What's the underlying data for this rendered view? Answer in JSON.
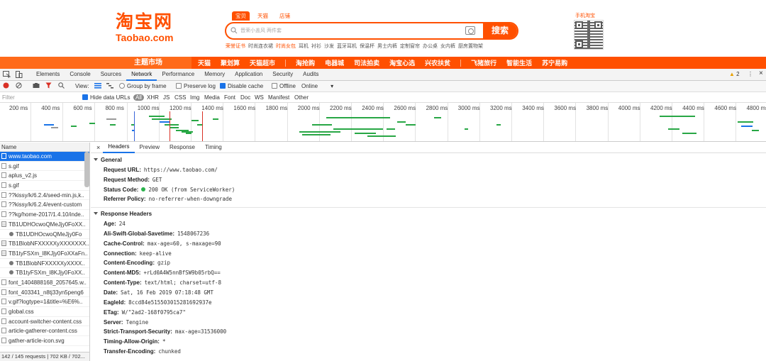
{
  "taobao": {
    "logo_cn": "淘宝网",
    "logo_en": "Taobao.com",
    "search_tabs": [
      "宝贝",
      "天猫",
      "店铺"
    ],
    "search_placeholder": "晋荣小盖风 两件套",
    "search_button": "搜索",
    "hotwords": [
      "荣誉证书",
      "时尚连衣裙",
      "时尚女包",
      "耳机",
      "衬衫",
      "沙发",
      "蓝牙耳机",
      "保温杯",
      "男士内裤",
      "定制窗帘",
      "办公桌",
      "女内裤",
      "厨房置物架"
    ],
    "mobile_label": "手机淘宝",
    "nav_theme": "主题市场",
    "nav_items": [
      "天猫",
      "聚划算",
      "天猫超市",
      "淘抢购",
      "电器城",
      "司法拍卖",
      "淘宝心选",
      "兴农扶贫",
      "飞猪旅行",
      "智能生活",
      "苏宁易购"
    ]
  },
  "devtools": {
    "tabs": [
      "Elements",
      "Console",
      "Sources",
      "Network",
      "Performance",
      "Memory",
      "Application",
      "Security",
      "Audits"
    ],
    "active_tab": "Network",
    "warnings_count": "2",
    "netbar": {
      "view_label": "View:",
      "group_by_frame": "Group by frame",
      "preserve_log": "Preserve log",
      "disable_cache": "Disable cache",
      "offline": "Offline",
      "throttle": "Online"
    },
    "filter": {
      "placeholder": "Filter",
      "hide_data_urls": "Hide data URLs",
      "types": [
        "All",
        "XHR",
        "JS",
        "CSS",
        "Img",
        "Media",
        "Font",
        "Doc",
        "WS",
        "Manifest",
        "Other"
      ]
    },
    "timeline_ticks": [
      "200 ms",
      "400 ms",
      "600 ms",
      "800 ms",
      "1000 ms",
      "1200 ms",
      "1400 ms",
      "1600 ms",
      "1800 ms",
      "2000 ms",
      "2200 ms",
      "2400 ms",
      "2600 ms",
      "2800 ms",
      "3000 ms",
      "3200 ms",
      "3400 ms",
      "3600 ms",
      "3800 ms",
      "4000 ms",
      "4200 ms",
      "4400 ms",
      "4600 ms",
      "4800 ms"
    ],
    "request_list": {
      "header": "Name",
      "rows": [
        {
          "name": "www.taobao.com",
          "kind": "doc"
        },
        {
          "name": "s.gif",
          "kind": "doc"
        },
        {
          "name": "aplus_v2.js",
          "kind": "doc"
        },
        {
          "name": "s.gif",
          "kind": "doc"
        },
        {
          "name": "??kissy/k/6.2.4/seed-min.js,k..",
          "kind": "doc"
        },
        {
          "name": "??kissy/k/6.2.4/event-custom",
          "kind": "doc"
        },
        {
          "name": "??kg/home-2017/1.4.10/inde..",
          "kind": "doc"
        },
        {
          "name": "TB1UDHOcwoQMeJjy0FoXX..",
          "kind": "img"
        },
        {
          "name": "TB1UDHOcwoQMeJjy0Fo",
          "kind": "gear"
        },
        {
          "name": "TB1BlobNFXXXXXyXXXXXXX..",
          "kind": "img"
        },
        {
          "name": "TB1tyFSXm_l8KJjy0FoXXaFn..",
          "kind": "img"
        },
        {
          "name": "TB1BlobNFXXXXXyXXXX..",
          "kind": "gear"
        },
        {
          "name": "TB1tyFSXm_l8KJjy0FoXX..",
          "kind": "gear"
        },
        {
          "name": "font_1404888168_2057645.w..",
          "kind": "doc"
        },
        {
          "name": "font_403341_n8tj33yn5peng6",
          "kind": "doc"
        },
        {
          "name": "v.gif?logtype=1&title=%E6%..",
          "kind": "doc"
        },
        {
          "name": "global.css",
          "kind": "doc"
        },
        {
          "name": "account-switcher-content.css",
          "kind": "doc"
        },
        {
          "name": "article-gatherer-content.css",
          "kind": "doc"
        },
        {
          "name": "gather-article-icon.svg",
          "kind": "doc"
        }
      ],
      "status": "142 / 145 requests | 702 KB / 702..."
    },
    "detail": {
      "tabs": [
        "Headers",
        "Preview",
        "Response",
        "Timing"
      ],
      "active_tab": "Headers",
      "general_title": "General",
      "general": [
        {
          "k": "Request URL:",
          "v": "https://www.taobao.com/"
        },
        {
          "k": "Request Method:",
          "v": "GET"
        },
        {
          "k": "Status Code:",
          "v": "200 OK (from ServiceWorker)"
        },
        {
          "k": "Referrer Policy:",
          "v": "no-referrer-when-downgrade"
        }
      ],
      "response_title": "Response Headers",
      "response": [
        {
          "k": "Age:",
          "v": "24"
        },
        {
          "k": "Ali-Swift-Global-Savetime:",
          "v": "1548067236"
        },
        {
          "k": "Cache-Control:",
          "v": "max-age=60, s-maxage=90"
        },
        {
          "k": "Connection:",
          "v": "keep-alive"
        },
        {
          "k": "Content-Encoding:",
          "v": "gzip"
        },
        {
          "k": "Content-MD5:",
          "v": "+rLd0A4W5nnBfSW9b05rbQ=="
        },
        {
          "k": "Content-Type:",
          "v": "text/html; charset=utf-8"
        },
        {
          "k": "Date:",
          "v": "Sat, 16 Feb 2019 07:18:48 GMT"
        },
        {
          "k": "EagleId:",
          "v": "8ccd84e515503015281692937e"
        },
        {
          "k": "ETag:",
          "v": "W/\"2ad2-168f0795ca7\""
        },
        {
          "k": "Server:",
          "v": "Tengine"
        },
        {
          "k": "Strict-Transport-Security:",
          "v": "max-age=31536000"
        },
        {
          "k": "Timing-Allow-Origin:",
          "v": "*"
        },
        {
          "k": "Transfer-Encoding:",
          "v": "chunked"
        }
      ]
    }
  }
}
